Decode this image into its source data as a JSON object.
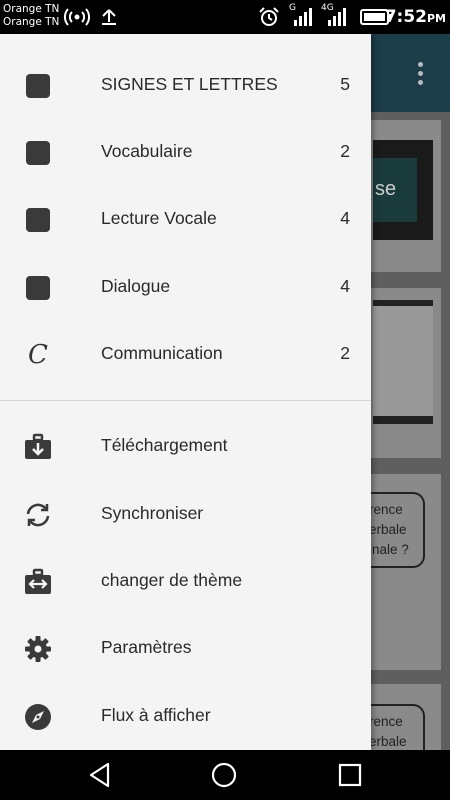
{
  "status_bar": {
    "carrier_1": "Orange TN",
    "carrier_2": "Orange TN",
    "time": "7:52",
    "ampm": "PM",
    "network_1": "G",
    "network_2": "4G"
  },
  "drawer": {
    "categories": [
      {
        "label": "SIGNES ET LETTRES",
        "count": "5",
        "icon": "square-icon"
      },
      {
        "label": "Vocabulaire",
        "count": "2",
        "icon": "square-icon"
      },
      {
        "label": "Lecture Vocale",
        "count": "4",
        "icon": "square-icon"
      },
      {
        "label": "Dialogue",
        "count": "4",
        "icon": "square-icon"
      },
      {
        "label": "Communication",
        "count": "2",
        "icon": "letter-c-icon"
      }
    ],
    "actions": [
      {
        "label": "Téléchargement",
        "icon": "download-briefcase-icon"
      },
      {
        "label": "Synchroniser",
        "icon": "sync-icon"
      },
      {
        "label": "changer de thème",
        "icon": "swap-theme-icon"
      },
      {
        "label": "Paramètres",
        "icon": "gear-icon"
      },
      {
        "label": "Flux à afficher",
        "icon": "compass-icon"
      }
    ]
  },
  "background_cards": [
    {
      "text": "se"
    },
    {
      "text": ""
    },
    {
      "text_lines": [
        "rence",
        "erbale",
        "inale ?"
      ]
    },
    {
      "text_lines": [
        "rence",
        "erbale"
      ]
    }
  ],
  "colors": {
    "drawer_bg": "#f4f4f4",
    "text": "#2a2a2a",
    "icon": "#3a3a3a",
    "toolbar": "#1c3d4a"
  }
}
